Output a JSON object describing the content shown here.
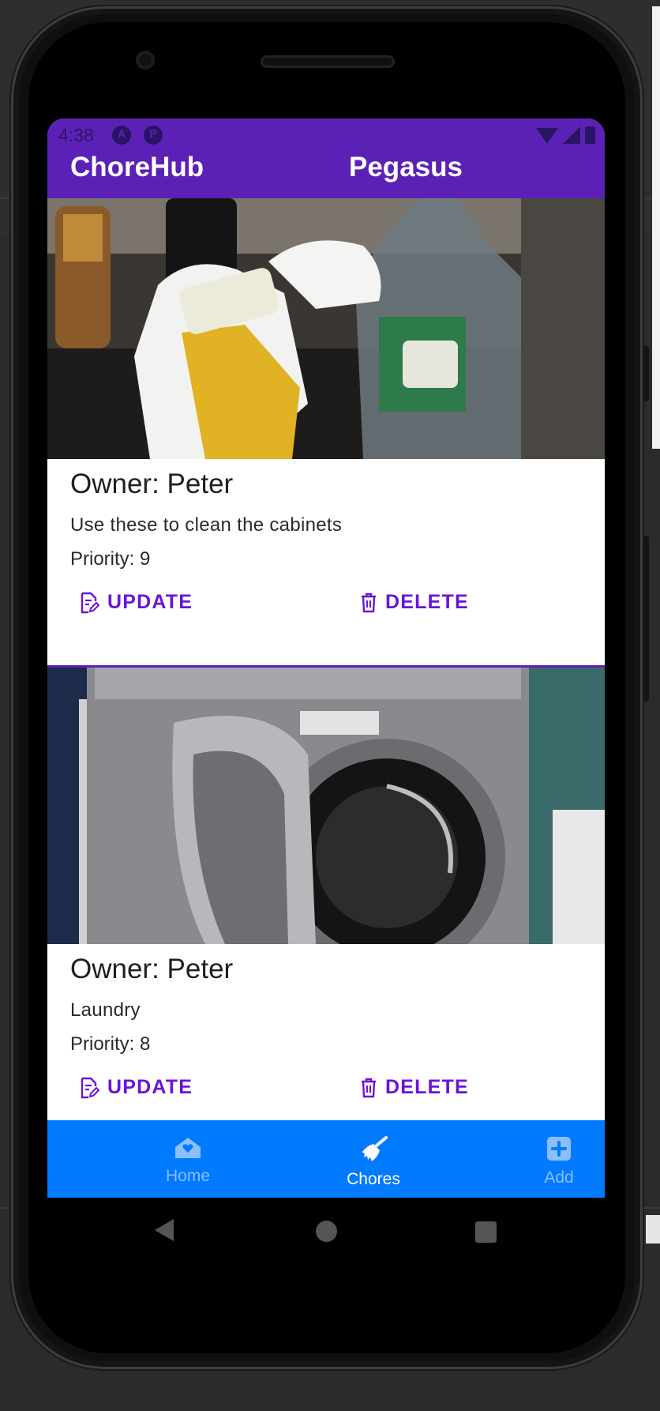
{
  "status_bar": {
    "time": "4:38"
  },
  "app_bar": {
    "title": "ChoreHub",
    "user": "Pegasus"
  },
  "chores": [
    {
      "owner": "Owner: Peter",
      "description": "Use these to clean the cabinets",
      "priority": "Priority: 9",
      "update_label": "UPDATE",
      "delete_label": "DELETE"
    },
    {
      "owner": "Owner: Peter",
      "description": "Laundry",
      "priority": "Priority: 8",
      "update_label": "UPDATE",
      "delete_label": "DELETE"
    }
  ],
  "bottom_nav": {
    "items": [
      {
        "label": "Home",
        "icon": "home-icon"
      },
      {
        "label": "Chores",
        "icon": "broom-icon"
      },
      {
        "label": "Add",
        "icon": "add-square-icon"
      }
    ],
    "active": "Chores"
  },
  "colors": {
    "app_bar": "#5b21b6",
    "accent": "#6a14d8",
    "bottom_nav": "#007aff"
  }
}
